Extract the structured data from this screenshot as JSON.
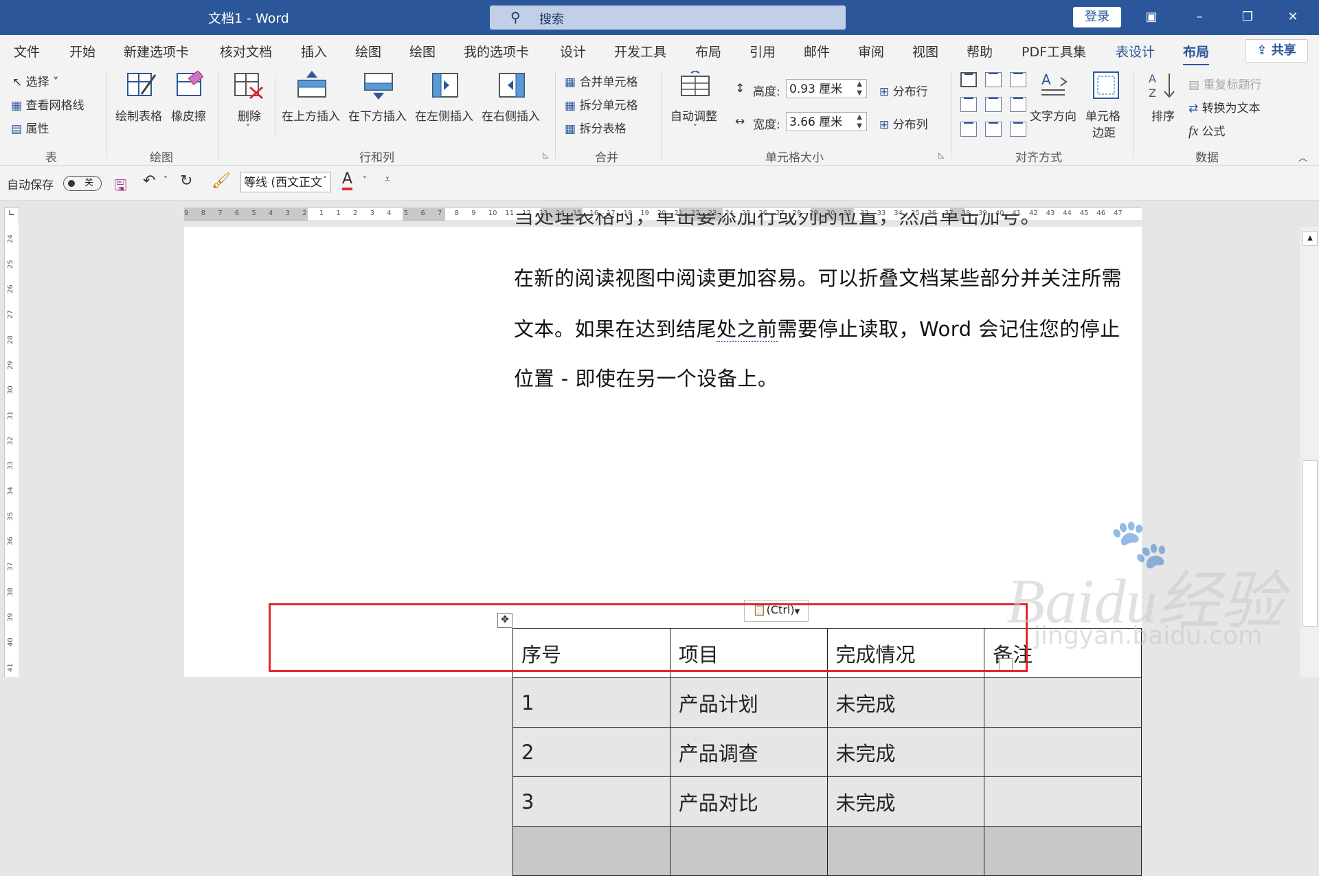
{
  "window": {
    "title": "文档1  -  Word",
    "search_placeholder": "搜索",
    "login_label": "登录"
  },
  "tabs": [
    {
      "label": "文件"
    },
    {
      "label": "开始"
    },
    {
      "label": "新建选项卡"
    },
    {
      "label": "核对文档"
    },
    {
      "label": "插入"
    },
    {
      "label": "绘图"
    },
    {
      "label": "绘图"
    },
    {
      "label": "我的选项卡"
    },
    {
      "label": "设计"
    },
    {
      "label": "开发工具"
    },
    {
      "label": "布局"
    },
    {
      "label": "引用"
    },
    {
      "label": "邮件"
    },
    {
      "label": "审阅"
    },
    {
      "label": "视图"
    },
    {
      "label": "帮助"
    },
    {
      "label": "PDF工具集"
    },
    {
      "label": "表设计"
    },
    {
      "label": "布局"
    }
  ],
  "share_label": "共享",
  "ribbon": {
    "table": {
      "select": "选择",
      "gridlines": "查看网格线",
      "properties": "属性",
      "group": "表"
    },
    "draw": {
      "draw_table": "绘制表格",
      "eraser": "橡皮擦",
      "group": "绘图"
    },
    "rows_cols": {
      "delete": "删除",
      "insert_above": "在上方插入",
      "insert_below": "在下方插入",
      "insert_left": "在左侧插入",
      "insert_right": "在右侧插入",
      "group": "行和列"
    },
    "merge": {
      "merge_cells": "合并单元格",
      "split_cells": "拆分单元格",
      "split_table": "拆分表格",
      "group": "合并"
    },
    "cell_size": {
      "autofit": "自动调整",
      "height_label": "高度:",
      "height_value": "0.93 厘米",
      "width_label": "宽度:",
      "width_value": "3.66 厘米",
      "distribute_rows": "分布行",
      "distribute_cols": "分布列",
      "group": "单元格大小"
    },
    "alignment": {
      "text_direction": "文字方向",
      "cell_margins_1": "单元格",
      "cell_margins_2": "边距",
      "group": "对齐方式"
    },
    "data": {
      "sort": "排序",
      "repeat_header": "重复标题行",
      "convert_text": "转换为文本",
      "formula": "公式",
      "group": "数据"
    }
  },
  "qat": {
    "autosave_label": "自动保存",
    "autosave_state": "关",
    "font_name": "等线 (西文正文"
  },
  "hruler": [
    "9",
    "8",
    "7",
    "6",
    "5",
    "4",
    "3",
    "2",
    "1",
    "1",
    "2",
    "3",
    "4",
    "5",
    "6",
    "7",
    "8",
    "9",
    "10",
    "11",
    "12",
    "13",
    "14",
    "15",
    "16",
    "17",
    "18",
    "19",
    "20",
    "21",
    "22",
    "23",
    "24",
    "25",
    "26",
    "27",
    "28",
    "29",
    "30",
    "31",
    "32",
    "33",
    "34",
    "35",
    "36",
    "37",
    "38",
    "39",
    "40",
    "41",
    "42",
    "43",
    "44",
    "45",
    "46",
    "47"
  ],
  "vruler": [
    "24",
    "25",
    "26",
    "27",
    "28",
    "29",
    "30",
    "31",
    "32",
    "33",
    "34",
    "35",
    "36",
    "37",
    "38",
    "39",
    "40",
    "41"
  ],
  "document": {
    "para_top": "当处理表格时，单击要添加行或列的位置，然后单击加号。",
    "para_lines": [
      "在新的阅读视图中阅读更加容易。可以折叠文档某些部分并关注所需",
      "位置  -  即使在另一个设备上。"
    ],
    "para_line2": {
      "before": "文本。如果在达到结尾",
      "underlined": "处之前",
      "after": "需要停止读取，Word  会记住您的停止"
    },
    "table": {
      "header": [
        "序号",
        "项目",
        "完成情况",
        "备注"
      ],
      "rows": [
        [
          "1",
          "产品计划",
          "未完成",
          ""
        ],
        [
          "2",
          "产品调查",
          "未完成",
          ""
        ],
        [
          "3",
          "产品对比",
          "未完成",
          ""
        ]
      ]
    },
    "paste_options_label": "(Ctrl)"
  },
  "watermark": {
    "brand": "Baidu经验",
    "url": "jingyan.baidu.com"
  }
}
